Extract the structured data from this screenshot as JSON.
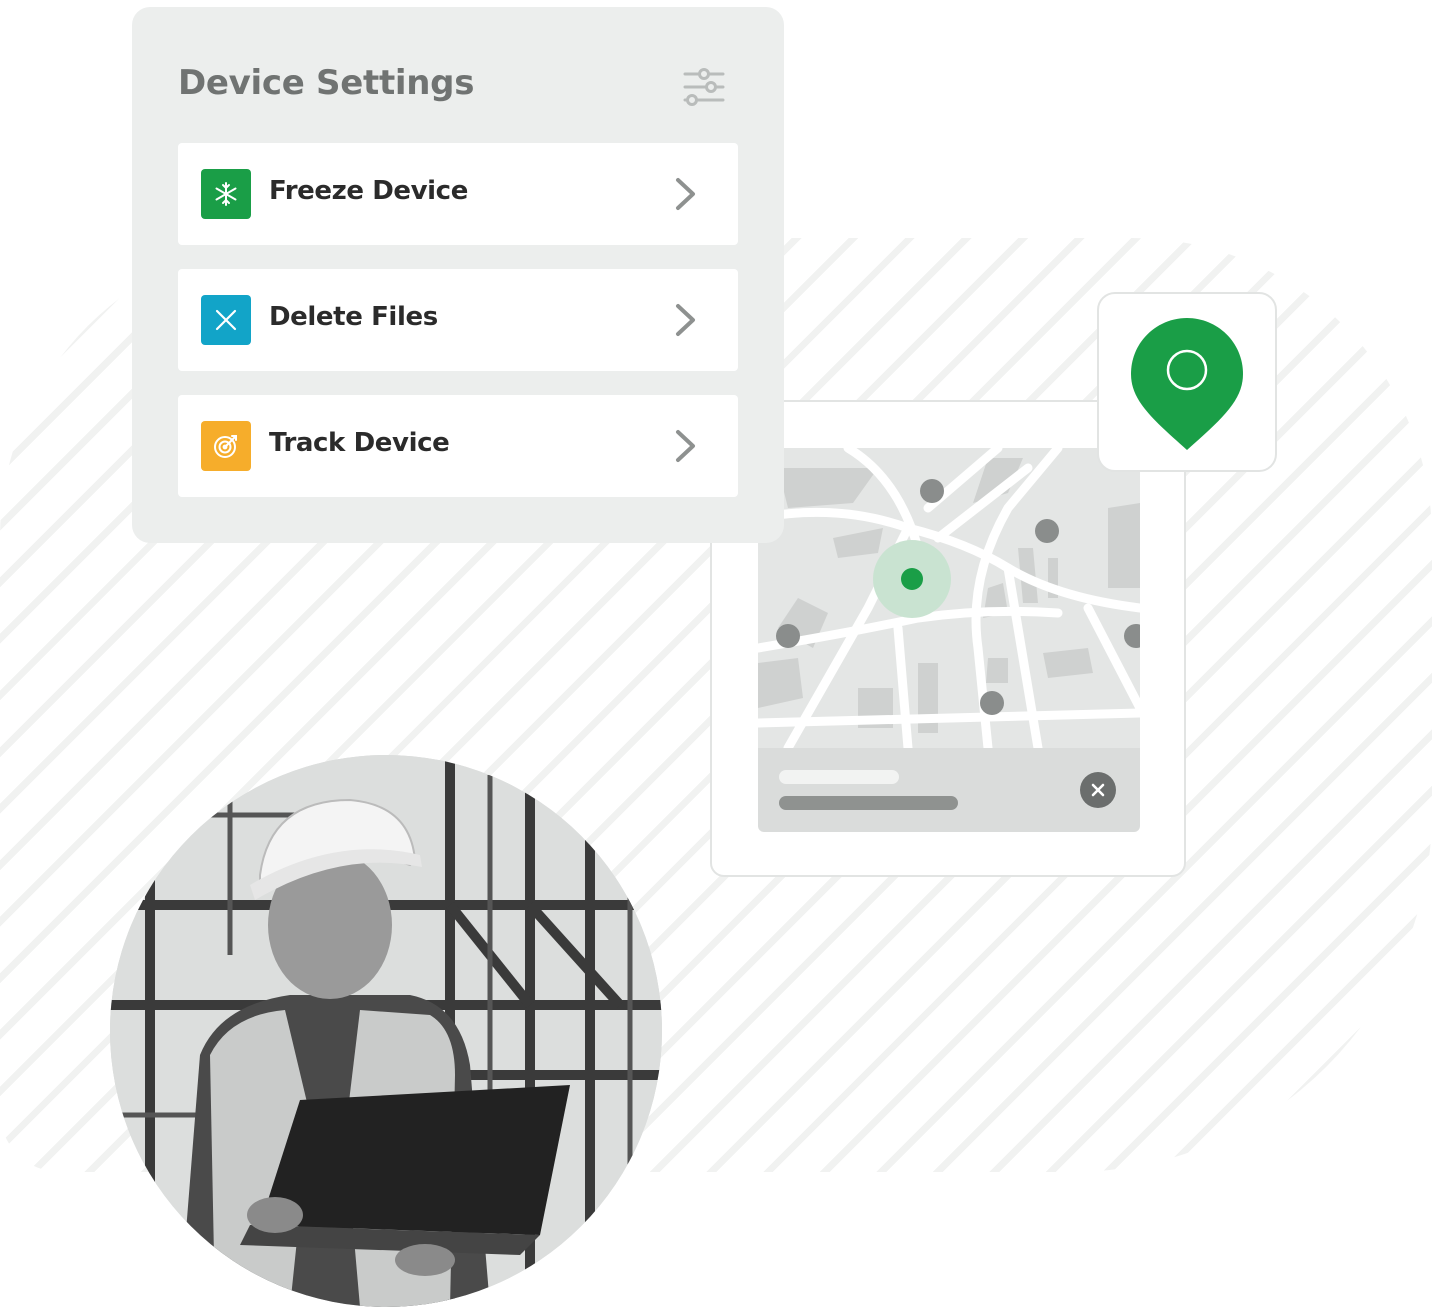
{
  "settings_panel": {
    "title": "Device Settings",
    "filter_icon": "sliders-icon",
    "options": [
      {
        "label": "Freeze Device",
        "icon": "snowflake-icon",
        "color": "#1a9e47"
      },
      {
        "label": "Delete Files",
        "icon": "x-icon",
        "color": "#12a4c8"
      },
      {
        "label": "Track Device",
        "icon": "target-icon",
        "color": "#f6ad2b"
      }
    ],
    "chevron_icon": "chevron-right-icon"
  },
  "map_panel": {
    "current_location_color": "#1a9e47",
    "close_icon": "close-circle-icon"
  },
  "pin_panel": {
    "icon": "map-pin-icon",
    "color": "#1a9e47"
  },
  "photo": {
    "icon": "worker-photo"
  }
}
